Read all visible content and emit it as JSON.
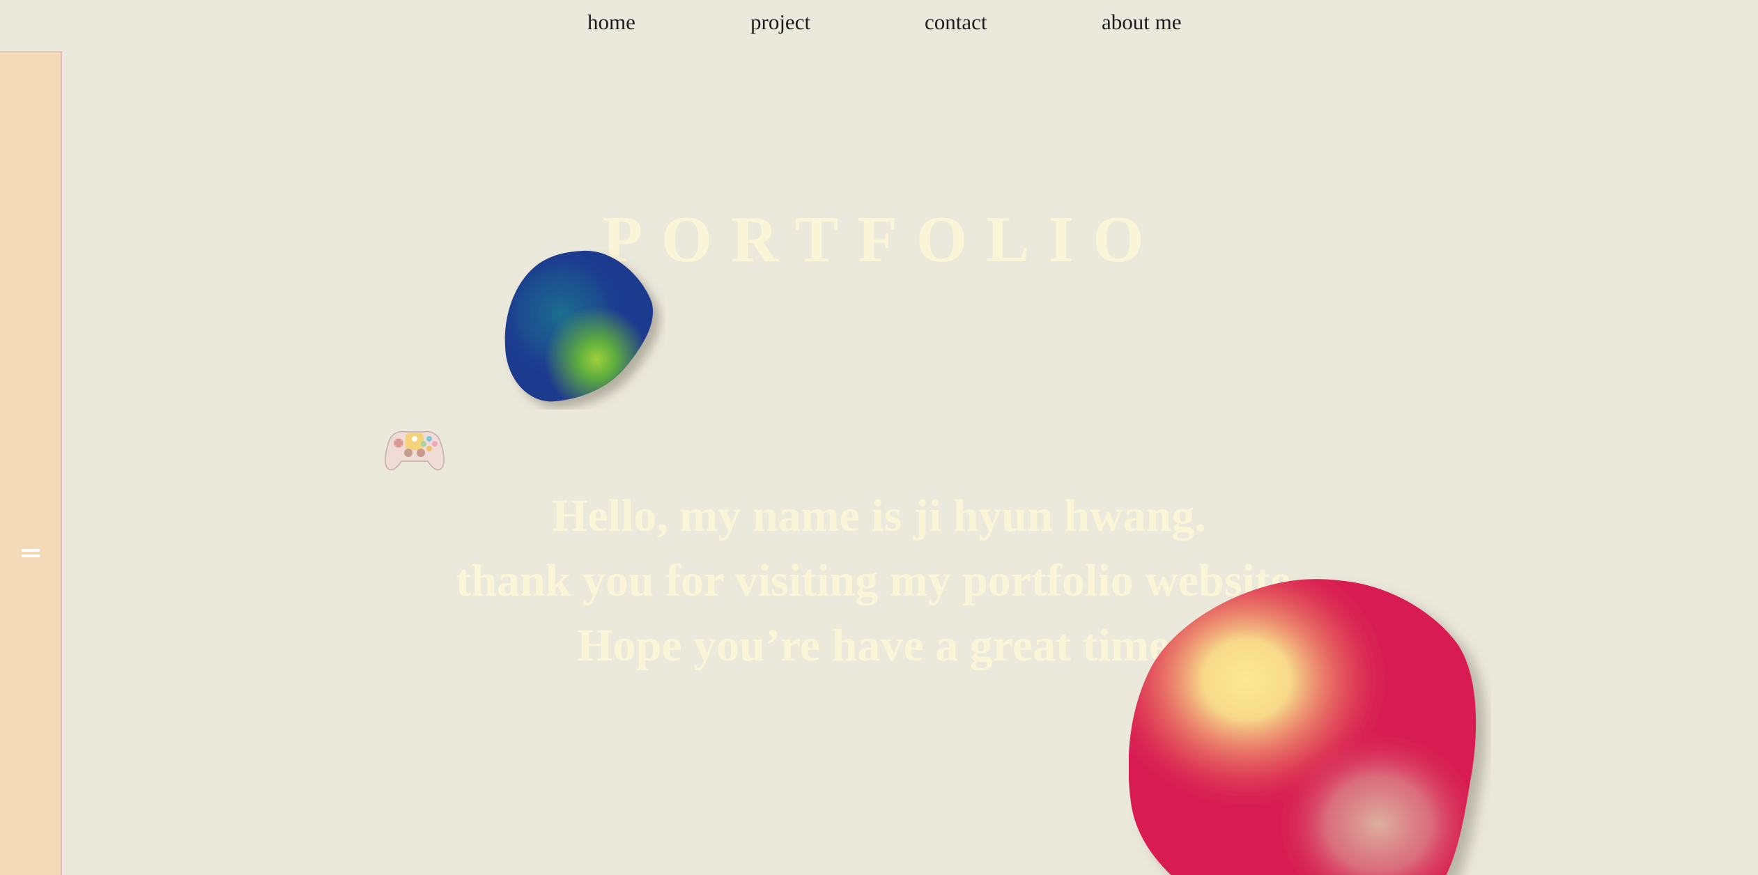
{
  "nav": {
    "items": [
      {
        "label": "home"
      },
      {
        "label": "project"
      },
      {
        "label": "contact"
      },
      {
        "label": "about me"
      }
    ]
  },
  "sidebar": {
    "menu_icon": "hamburger-menu-icon"
  },
  "hero": {
    "title": "PORTFOLIO",
    "lines": [
      "Hello, my name is ji hyun hwang.",
      "thank you for visiting my portfolio website.",
      "Hope you’re have a great time."
    ]
  },
  "decor": {
    "blue_blob_icon": "blue-gradient-blob",
    "red_blob_icon": "red-gradient-blob",
    "controller_icon": "game-controller-icon"
  },
  "colors": {
    "background": "#ebe8dc",
    "sidebar": "#f3d9b8",
    "sidebar_border": "#eab6c9",
    "title_text": "#fbf5d8",
    "nav_text": "#1b1b1b",
    "blob_blue": "#1f3a8f",
    "blob_green": "#8bc63f",
    "blob_red": "#d81e52",
    "blob_yellow": "#f9e38f"
  }
}
